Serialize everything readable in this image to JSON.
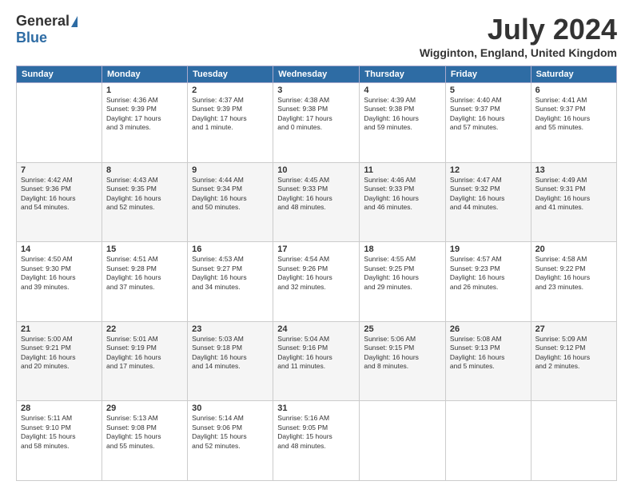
{
  "header": {
    "logo_general": "General",
    "logo_blue": "Blue",
    "title": "July 2024",
    "location": "Wigginton, England, United Kingdom"
  },
  "days_of_week": [
    "Sunday",
    "Monday",
    "Tuesday",
    "Wednesday",
    "Thursday",
    "Friday",
    "Saturday"
  ],
  "weeks": [
    [
      {
        "day": "",
        "info": ""
      },
      {
        "day": "1",
        "info": "Sunrise: 4:36 AM\nSunset: 9:39 PM\nDaylight: 17 hours\nand 3 minutes."
      },
      {
        "day": "2",
        "info": "Sunrise: 4:37 AM\nSunset: 9:39 PM\nDaylight: 17 hours\nand 1 minute."
      },
      {
        "day": "3",
        "info": "Sunrise: 4:38 AM\nSunset: 9:38 PM\nDaylight: 17 hours\nand 0 minutes."
      },
      {
        "day": "4",
        "info": "Sunrise: 4:39 AM\nSunset: 9:38 PM\nDaylight: 16 hours\nand 59 minutes."
      },
      {
        "day": "5",
        "info": "Sunrise: 4:40 AM\nSunset: 9:37 PM\nDaylight: 16 hours\nand 57 minutes."
      },
      {
        "day": "6",
        "info": "Sunrise: 4:41 AM\nSunset: 9:37 PM\nDaylight: 16 hours\nand 55 minutes."
      }
    ],
    [
      {
        "day": "7",
        "info": "Sunrise: 4:42 AM\nSunset: 9:36 PM\nDaylight: 16 hours\nand 54 minutes."
      },
      {
        "day": "8",
        "info": "Sunrise: 4:43 AM\nSunset: 9:35 PM\nDaylight: 16 hours\nand 52 minutes."
      },
      {
        "day": "9",
        "info": "Sunrise: 4:44 AM\nSunset: 9:34 PM\nDaylight: 16 hours\nand 50 minutes."
      },
      {
        "day": "10",
        "info": "Sunrise: 4:45 AM\nSunset: 9:33 PM\nDaylight: 16 hours\nand 48 minutes."
      },
      {
        "day": "11",
        "info": "Sunrise: 4:46 AM\nSunset: 9:33 PM\nDaylight: 16 hours\nand 46 minutes."
      },
      {
        "day": "12",
        "info": "Sunrise: 4:47 AM\nSunset: 9:32 PM\nDaylight: 16 hours\nand 44 minutes."
      },
      {
        "day": "13",
        "info": "Sunrise: 4:49 AM\nSunset: 9:31 PM\nDaylight: 16 hours\nand 41 minutes."
      }
    ],
    [
      {
        "day": "14",
        "info": "Sunrise: 4:50 AM\nSunset: 9:30 PM\nDaylight: 16 hours\nand 39 minutes."
      },
      {
        "day": "15",
        "info": "Sunrise: 4:51 AM\nSunset: 9:28 PM\nDaylight: 16 hours\nand 37 minutes."
      },
      {
        "day": "16",
        "info": "Sunrise: 4:53 AM\nSunset: 9:27 PM\nDaylight: 16 hours\nand 34 minutes."
      },
      {
        "day": "17",
        "info": "Sunrise: 4:54 AM\nSunset: 9:26 PM\nDaylight: 16 hours\nand 32 minutes."
      },
      {
        "day": "18",
        "info": "Sunrise: 4:55 AM\nSunset: 9:25 PM\nDaylight: 16 hours\nand 29 minutes."
      },
      {
        "day": "19",
        "info": "Sunrise: 4:57 AM\nSunset: 9:23 PM\nDaylight: 16 hours\nand 26 minutes."
      },
      {
        "day": "20",
        "info": "Sunrise: 4:58 AM\nSunset: 9:22 PM\nDaylight: 16 hours\nand 23 minutes."
      }
    ],
    [
      {
        "day": "21",
        "info": "Sunrise: 5:00 AM\nSunset: 9:21 PM\nDaylight: 16 hours\nand 20 minutes."
      },
      {
        "day": "22",
        "info": "Sunrise: 5:01 AM\nSunset: 9:19 PM\nDaylight: 16 hours\nand 17 minutes."
      },
      {
        "day": "23",
        "info": "Sunrise: 5:03 AM\nSunset: 9:18 PM\nDaylight: 16 hours\nand 14 minutes."
      },
      {
        "day": "24",
        "info": "Sunrise: 5:04 AM\nSunset: 9:16 PM\nDaylight: 16 hours\nand 11 minutes."
      },
      {
        "day": "25",
        "info": "Sunrise: 5:06 AM\nSunset: 9:15 PM\nDaylight: 16 hours\nand 8 minutes."
      },
      {
        "day": "26",
        "info": "Sunrise: 5:08 AM\nSunset: 9:13 PM\nDaylight: 16 hours\nand 5 minutes."
      },
      {
        "day": "27",
        "info": "Sunrise: 5:09 AM\nSunset: 9:12 PM\nDaylight: 16 hours\nand 2 minutes."
      }
    ],
    [
      {
        "day": "28",
        "info": "Sunrise: 5:11 AM\nSunset: 9:10 PM\nDaylight: 15 hours\nand 58 minutes."
      },
      {
        "day": "29",
        "info": "Sunrise: 5:13 AM\nSunset: 9:08 PM\nDaylight: 15 hours\nand 55 minutes."
      },
      {
        "day": "30",
        "info": "Sunrise: 5:14 AM\nSunset: 9:06 PM\nDaylight: 15 hours\nand 52 minutes."
      },
      {
        "day": "31",
        "info": "Sunrise: 5:16 AM\nSunset: 9:05 PM\nDaylight: 15 hours\nand 48 minutes."
      },
      {
        "day": "",
        "info": ""
      },
      {
        "day": "",
        "info": ""
      },
      {
        "day": "",
        "info": ""
      }
    ]
  ]
}
